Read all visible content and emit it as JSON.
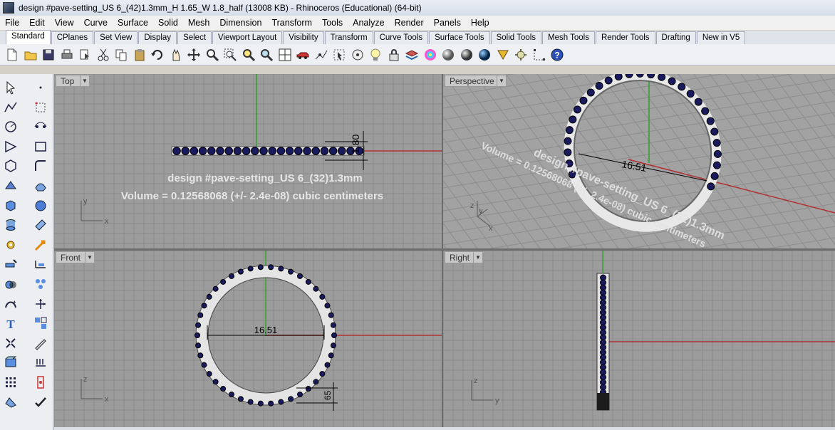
{
  "window": {
    "title": "design #pave-setting_US 6_(42)1.3mm_H 1.65_W 1.8_half (13008 KB) - Rhinoceros (Educational) (64-bit)"
  },
  "menu": [
    "File",
    "Edit",
    "View",
    "Curve",
    "Surface",
    "Solid",
    "Mesh",
    "Dimension",
    "Transform",
    "Tools",
    "Analyze",
    "Render",
    "Panels",
    "Help"
  ],
  "tabs": [
    "Standard",
    "CPlanes",
    "Set View",
    "Display",
    "Select",
    "Viewport Layout",
    "Visibility",
    "Transform",
    "Curve Tools",
    "Surface Tools",
    "Solid Tools",
    "Mesh Tools",
    "Render Tools",
    "Drafting",
    "New in V5"
  ],
  "active_tab": "Standard",
  "viewports": {
    "top": {
      "label": "Top",
      "annotation_line1": "design #pave-setting_US 6_(32)1.3mm",
      "annotation_line2": "Volume = 0.12568068 (+/- 2.4e-08) cubic centimeters",
      "dimension": "1.80",
      "axis_x": "x",
      "axis_y": "y"
    },
    "perspective": {
      "label": "Perspective",
      "annotation_line1": "design #pave-setting_US 6_(32)1.3mm",
      "annotation_line2": "Volume = 0.12568068 (+/- 2.4e-08) cubic centimeters",
      "dimension": "16.51",
      "axis_x": "x",
      "axis_y": "y",
      "axis_z": "z"
    },
    "front": {
      "label": "Front",
      "dimension": "16.51",
      "small_dimension": "65",
      "axis_x": "x",
      "axis_z": "z"
    },
    "right": {
      "label": "Right",
      "axis_y": "y",
      "axis_z": "z"
    }
  },
  "colors": {
    "grid_bg": "#9c9c9c",
    "grid_line": "#8a8a8a",
    "x_axis": "#b03030",
    "y_axis": "#30a030",
    "gem": "#1a1a5e",
    "metal": "#e4e4e4"
  },
  "toolbar_icons": [
    "new-file-icon",
    "open-file-icon",
    "save-icon",
    "print-icon",
    "import-icon",
    "cut-icon",
    "copy-icon",
    "paste-icon",
    "undo-icon",
    "pan-icon",
    "rotate-icon",
    "zoom-icon",
    "zoom-window-icon",
    "zoom-extents-icon",
    "zoom-selected-icon",
    "four-viewports-icon",
    "car-icon",
    "point-icon",
    "select-icon",
    "circle-icon",
    "light-icon",
    "lock-icon",
    "layer-icon",
    "color-icon",
    "sphere-icon",
    "shaded-sphere-icon",
    "render-sphere-icon",
    "lamp-icon",
    "props-icon",
    "dim-icon",
    "help-icon"
  ],
  "left_icons": [
    "select-arrow-icon",
    "point-icon",
    "polyline-icon",
    "point-cloud-icon",
    "arc-icon",
    "point-grid-icon",
    "curve-tool-icon",
    "rectangle-icon",
    "polygon-icon",
    "curve-fillet-icon",
    "extrude-icon",
    "surface-icon",
    "box-icon",
    "sphere-icon",
    "cylinder-icon",
    "patch-icon",
    "gear-icon",
    "transform-icon",
    "pipe-icon",
    "dim-icon",
    "boolean-icon",
    "array-icon",
    "sweep-icon",
    "move-icon",
    "text-icon",
    "group-icon",
    "explode-icon",
    "edit-icon",
    "solid-edit-icon",
    "mesh-icon",
    "grid-icon",
    "palette-icon",
    "ruler-icon",
    "check-icon"
  ]
}
